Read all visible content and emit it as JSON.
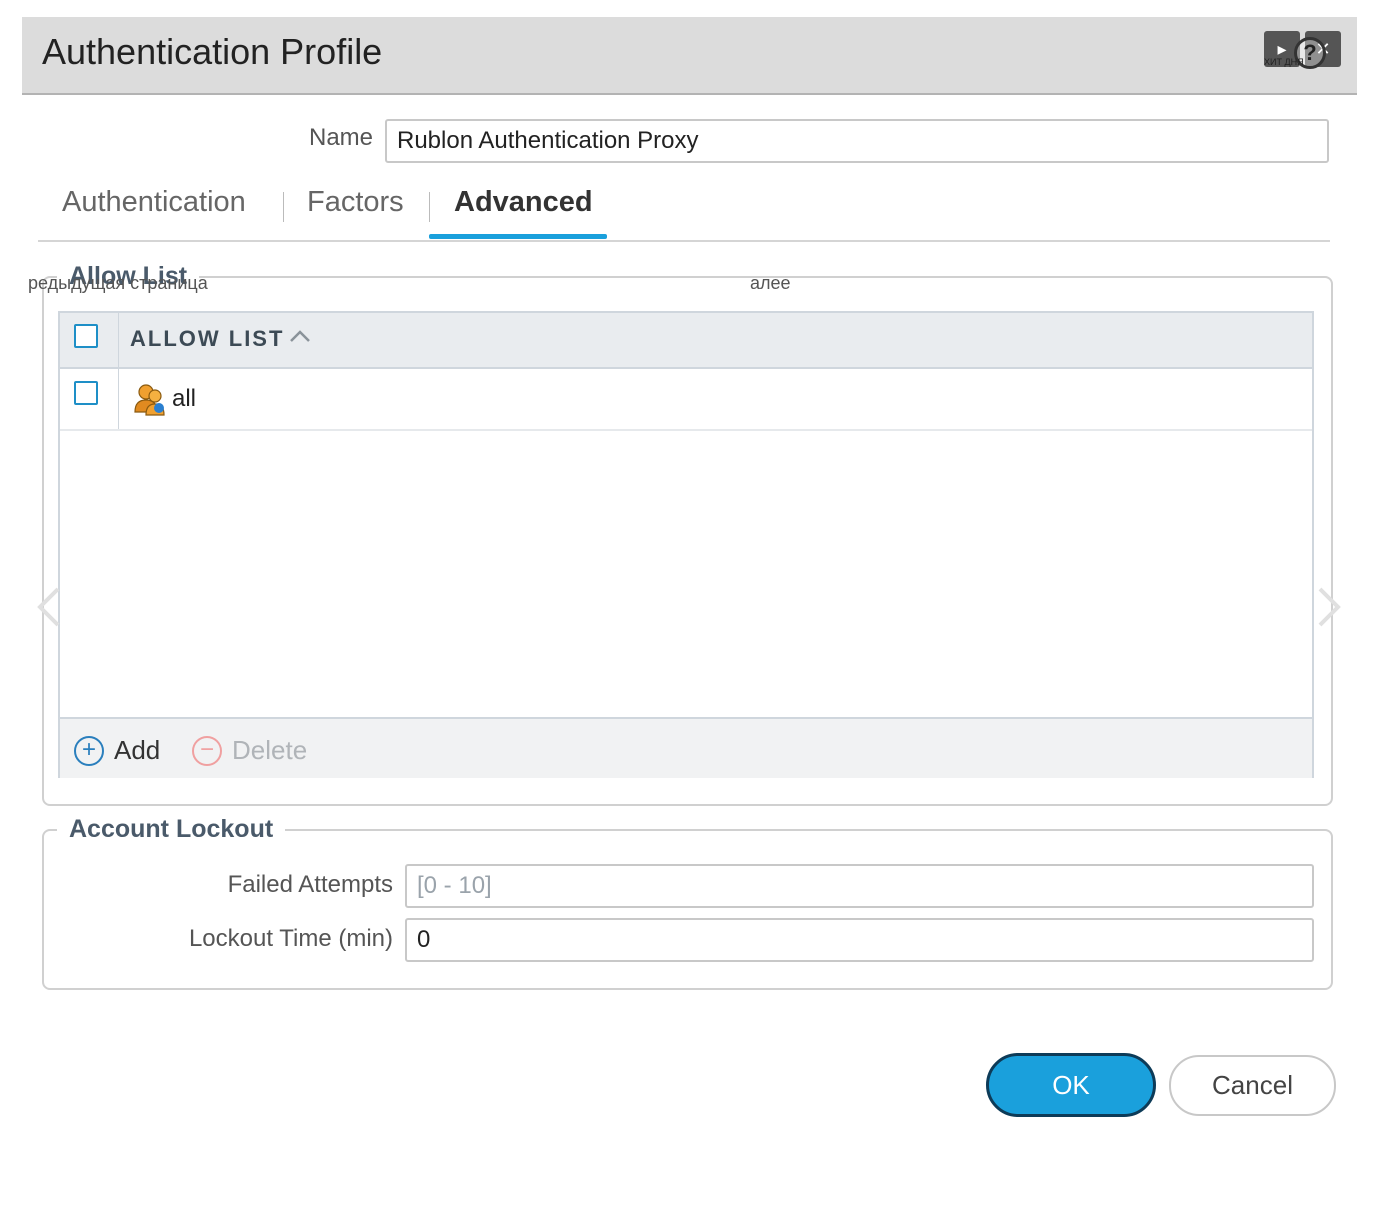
{
  "dialog": {
    "title": "Authentication Profile",
    "tiny_overlay": "ХИТ ДНЯ",
    "help_glyph": "?",
    "play_glyph": "▸",
    "close_glyph": "✕"
  },
  "name_field": {
    "label": "Name",
    "value": "Rublon Authentication Proxy"
  },
  "tabs": [
    {
      "label": "Authentication",
      "active": false
    },
    {
      "label": "Factors",
      "active": false
    },
    {
      "label": "Advanced",
      "active": true
    }
  ],
  "overlay": {
    "prev_page": "редыдущая страница",
    "next": "алее"
  },
  "allow_list": {
    "section_title": "Allow List",
    "column_header": "ALLOW LIST",
    "rows": [
      {
        "label": "all",
        "icon": "user-group-icon"
      }
    ],
    "add_label": "Add",
    "delete_label": "Delete"
  },
  "account_lockout": {
    "section_title": "Account Lockout",
    "failed_attempts": {
      "label": "Failed Attempts",
      "placeholder": "[0 - 10]",
      "value": ""
    },
    "lockout_time": {
      "label": "Lockout Time (min)",
      "value": "0"
    }
  },
  "buttons": {
    "ok": "OK",
    "cancel": "Cancel"
  },
  "colors": {
    "accent": "#1aa0dc",
    "title_bar": "#dcdcdc",
    "ok_border": "#0d3b58",
    "delete_disabled": "#f0a0a0"
  }
}
